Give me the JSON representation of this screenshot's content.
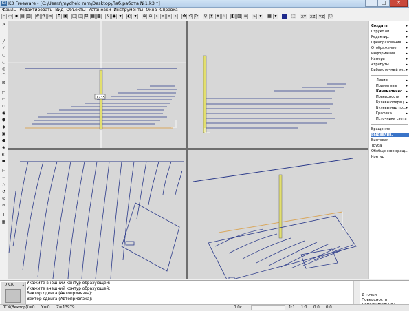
{
  "titlebar": {
    "app_icon": "K3",
    "title": "K3 Freeware - [C:\\Users\\mychek_mm\\Desktop\\Лаб.работа №1.k3 *]",
    "minimize": "–",
    "maximize": "□",
    "close": "✕"
  },
  "menu": [
    "Файлы",
    "Редактировать",
    "Вид",
    "Объекты",
    "Установки",
    "Инструменты",
    "Окна",
    "Справка"
  ],
  "toolbar": {
    "xy": "XY",
    "xz": "XZ",
    "yz": "YZ",
    "accent_color": "#1e2a8c"
  },
  "left_tools": [
    "↗",
    "·",
    "╱",
    "⁄",
    "○",
    "◌",
    "◎",
    "⌒",
    "⊠",
    "□",
    "▭",
    "⬭",
    "◉",
    "⬢",
    "◆",
    "▣",
    "⬣",
    "◈",
    "◐",
    "⬬",
    "⊢",
    "⊣",
    "△",
    "↺",
    "⊘",
    "✂",
    "T",
    "▦"
  ],
  "viewports": {
    "top_left": {
      "bg": "#d7d7d7",
      "cursor_label": "1735"
    },
    "top_right": {
      "bg": "#d7d7d7"
    },
    "bottom_left": {
      "bg": "#d7d7d7"
    },
    "bottom_right": {
      "bg": "#d7d7d7"
    },
    "line_color": "#2b3a8a",
    "highlight_color": "#e2df6e",
    "orange_color": "#d9a75c"
  },
  "right_panel": {
    "top_items": [
      {
        "label": "Создать",
        "arrow": "▸",
        "bold": true
      },
      {
        "label": "Структ.оп.",
        "arrow": "▸"
      },
      {
        "label": "Редактир.",
        "arrow": "▸"
      },
      {
        "label": "Преобразования",
        "arrow": "▸"
      },
      {
        "label": "Отображение",
        "arrow": "▸"
      },
      {
        "label": "Информация",
        "arrow": "▸"
      },
      {
        "label": "Камера",
        "arrow": "▸"
      },
      {
        "label": "Атрибуты",
        "arrow": "▸"
      },
      {
        "label": "Библиотечный эл...",
        "arrow": "▸"
      }
    ],
    "sub_items": [
      {
        "label": "Линии",
        "arrow": "▸"
      },
      {
        "label": "Примитивы",
        "arrow": "▸"
      },
      {
        "label": "Кинематичес...",
        "arrow": "▸",
        "bold": true
      },
      {
        "label": "Поверхности",
        "arrow": "▸"
      },
      {
        "label": "Булевы операц...",
        "arrow": "▸"
      },
      {
        "label": "Булевы над по...",
        "arrow": "▸"
      },
      {
        "label": "Графика",
        "arrow": "▸"
      },
      {
        "label": "Источники света",
        "arrow": ""
      }
    ],
    "kin_items": [
      {
        "label": "Вращение",
        "selected": false
      },
      {
        "label": "Выдавлив.",
        "selected": true
      },
      {
        "label": "Винтовая",
        "selected": false
      },
      {
        "label": "Труба",
        "selected": false
      },
      {
        "label": "Обобщенное вращ...",
        "selected": false
      },
      {
        "label": "Контур",
        "selected": false
      }
    ]
  },
  "command": {
    "label": "ЛСК",
    "number": "1",
    "lines": [
      "Укажите внешний контур образующей:",
      "Укажите внешний контур образующей:",
      "Вектор сдвига (Автопривязка):",
      "Вектор сдвига (Автопривязка):"
    ],
    "options": [
      "2 точки",
      "Поверхность",
      "Дополнительно"
    ],
    "options_arrow": "▸"
  },
  "status": {
    "mode": "ЛСК(Вектор)",
    "x": "X=",
    "x_val": "0",
    "y": "Y=",
    "y_val": "0",
    "z": "Z=",
    "z_val": "13979",
    "angle": "0.0c",
    "scale1": "1:1",
    "scale2": "1:1",
    "v1": "0.0",
    "v2": "0.0"
  }
}
